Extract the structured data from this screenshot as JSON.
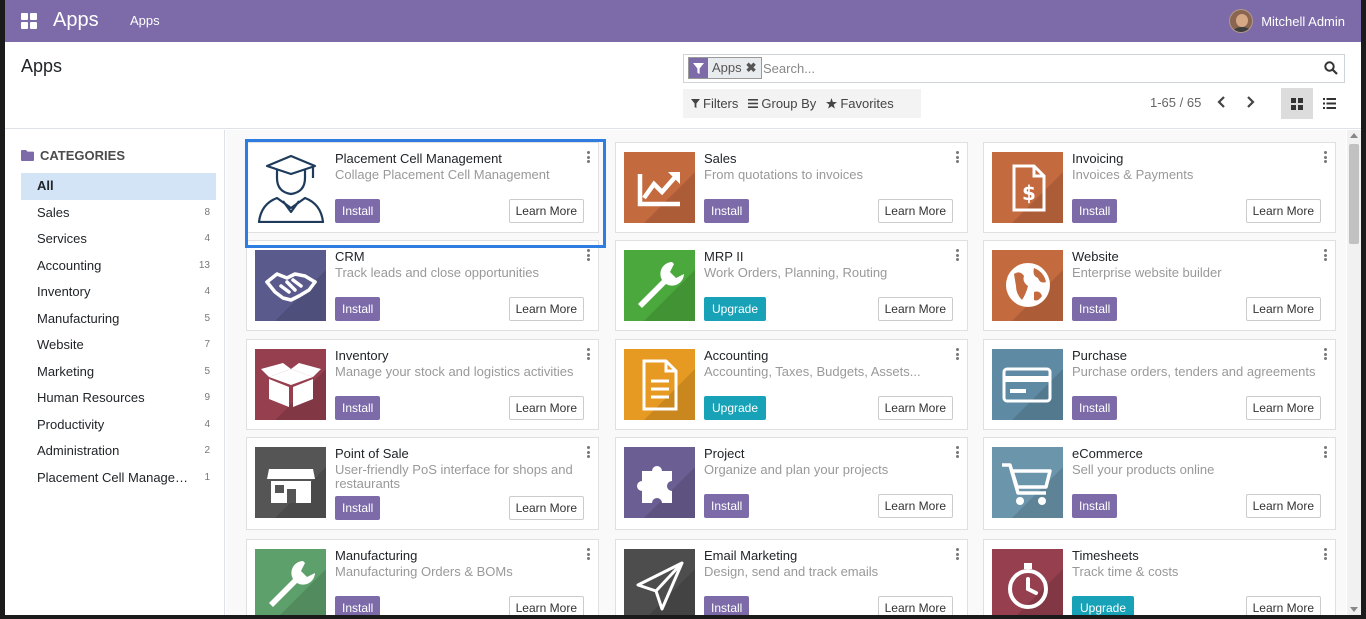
{
  "navbar": {
    "brand": "Apps",
    "menu_label": "Apps",
    "user_name": "Mitchell Admin"
  },
  "control": {
    "breadcrumb": "Apps",
    "facet_label": "Apps",
    "facet_close": "✖",
    "search_placeholder": "Search...",
    "filters_label": "Filters",
    "group_by_label": "Group By",
    "favorites_label": "Favorites",
    "pager": "1-65 / 65"
  },
  "sidebar": {
    "header": "CATEGORIES",
    "items": [
      {
        "name": "All",
        "count": ""
      },
      {
        "name": "Sales",
        "count": "8"
      },
      {
        "name": "Services",
        "count": "4"
      },
      {
        "name": "Accounting",
        "count": "13"
      },
      {
        "name": "Inventory",
        "count": "4"
      },
      {
        "name": "Manufacturing",
        "count": "5"
      },
      {
        "name": "Website",
        "count": "7"
      },
      {
        "name": "Marketing",
        "count": "5"
      },
      {
        "name": "Human Resources",
        "count": "9"
      },
      {
        "name": "Productivity",
        "count": "4"
      },
      {
        "name": "Administration",
        "count": "2"
      },
      {
        "name": "Placement Cell Management",
        "count": "1"
      }
    ]
  },
  "buttons": {
    "install": "Install",
    "upgrade": "Upgrade",
    "learn_more": "Learn More"
  },
  "cards": [
    {
      "title": "Placement Cell Management",
      "subtitle": "Collage Placement Cell Management",
      "action": "Install",
      "icon": "graduate-icon",
      "color": "#ffffff"
    },
    {
      "title": "Sales",
      "subtitle": "From quotations to invoices",
      "action": "Install",
      "icon": "trend-chart-icon",
      "color": "#c46a3f"
    },
    {
      "title": "Invoicing",
      "subtitle": "Invoices & Payments",
      "action": "Install",
      "icon": "invoice-dollar-icon",
      "color": "#c46a3f"
    },
    {
      "title": "CRM",
      "subtitle": "Track leads and close opportunities",
      "action": "Install",
      "icon": "handshake-icon",
      "color": "#5a5a8c"
    },
    {
      "title": "MRP II",
      "subtitle": "Work Orders, Planning, Routing",
      "action": "Upgrade",
      "icon": "wrench-icon",
      "color": "#4aa83c"
    },
    {
      "title": "Website",
      "subtitle": "Enterprise website builder",
      "action": "Install",
      "icon": "globe-icon",
      "color": "#c46a3f"
    },
    {
      "title": "Inventory",
      "subtitle": "Manage your stock and logistics activities",
      "action": "Install",
      "icon": "box-icon",
      "color": "#953f4f"
    },
    {
      "title": "Accounting",
      "subtitle": "Accounting, Taxes, Budgets, Assets...",
      "action": "Upgrade",
      "icon": "document-icon",
      "color": "#e69a22"
    },
    {
      "title": "Purchase",
      "subtitle": "Purchase orders, tenders and agreements",
      "action": "Install",
      "icon": "credit-card-icon",
      "color": "#5f8aa3"
    },
    {
      "title": "Point of Sale",
      "subtitle": "User-friendly PoS interface for shops and restaurants",
      "action": "Install",
      "icon": "shop-icon",
      "color": "#555555"
    },
    {
      "title": "Project",
      "subtitle": "Organize and plan your projects",
      "action": "Install",
      "icon": "puzzle-icon",
      "color": "#6a5e92"
    },
    {
      "title": "eCommerce",
      "subtitle": "Sell your products online",
      "action": "Install",
      "icon": "cart-icon",
      "color": "#6b95ab"
    },
    {
      "title": "Manufacturing",
      "subtitle": "Manufacturing Orders & BOMs",
      "action": "Install",
      "icon": "wrench-icon",
      "color": "#5ea06c"
    },
    {
      "title": "Email Marketing",
      "subtitle": "Design, send and track emails",
      "action": "Install",
      "icon": "paper-plane-icon",
      "color": "#4d4d4d"
    },
    {
      "title": "Timesheets",
      "subtitle": "Track time & costs",
      "action": "Upgrade",
      "icon": "stopwatch-icon",
      "color": "#953f4f"
    }
  ]
}
